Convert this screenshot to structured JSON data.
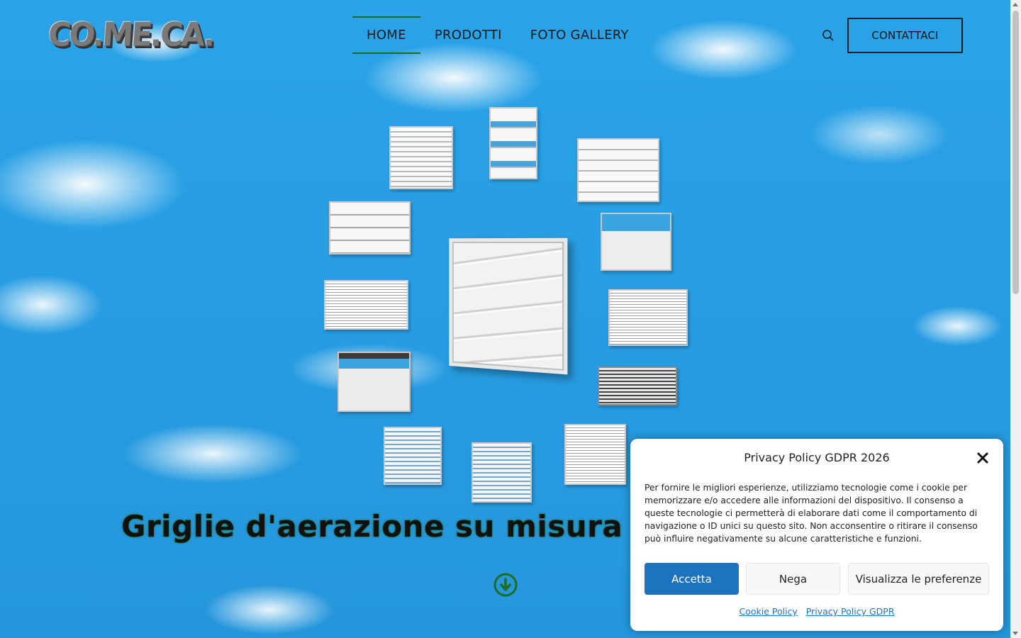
{
  "header": {
    "logo_text": "CO.ME.CA.",
    "nav": [
      {
        "label": "HOME",
        "active": true
      },
      {
        "label": "PRODOTTI",
        "active": false
      },
      {
        "label": "FOTO GALLERY",
        "active": false
      }
    ],
    "search_icon": "search-icon",
    "contact_label": "CONTATTACI"
  },
  "hero": {
    "headline": "Griglie d'aerazione su misura in",
    "scroll_icon": "arrow-down-circle-icon",
    "accent_color": "#1f6b1f"
  },
  "cookie": {
    "title": "Privacy Policy GDPR 2026",
    "text": "Per fornire le migliori esperienze, utilizziamo tecnologie come i cookie per memorizzare e/o accedere alle informazioni del dispositivo. Il consenso a queste tecnologie ci permetterà di elaborare dati come il comportamento di navigazione o ID unici su questo sito. Non acconsentire o ritirare il consenso può influire negativamente su alcune caratteristiche e funzioni.",
    "accept_label": "Accetta",
    "deny_label": "Nega",
    "prefs_label": "Visualizza le preferenze",
    "links": [
      "Cookie Policy",
      "Privacy Policy GDPR"
    ],
    "accent_color": "#1e73be"
  }
}
